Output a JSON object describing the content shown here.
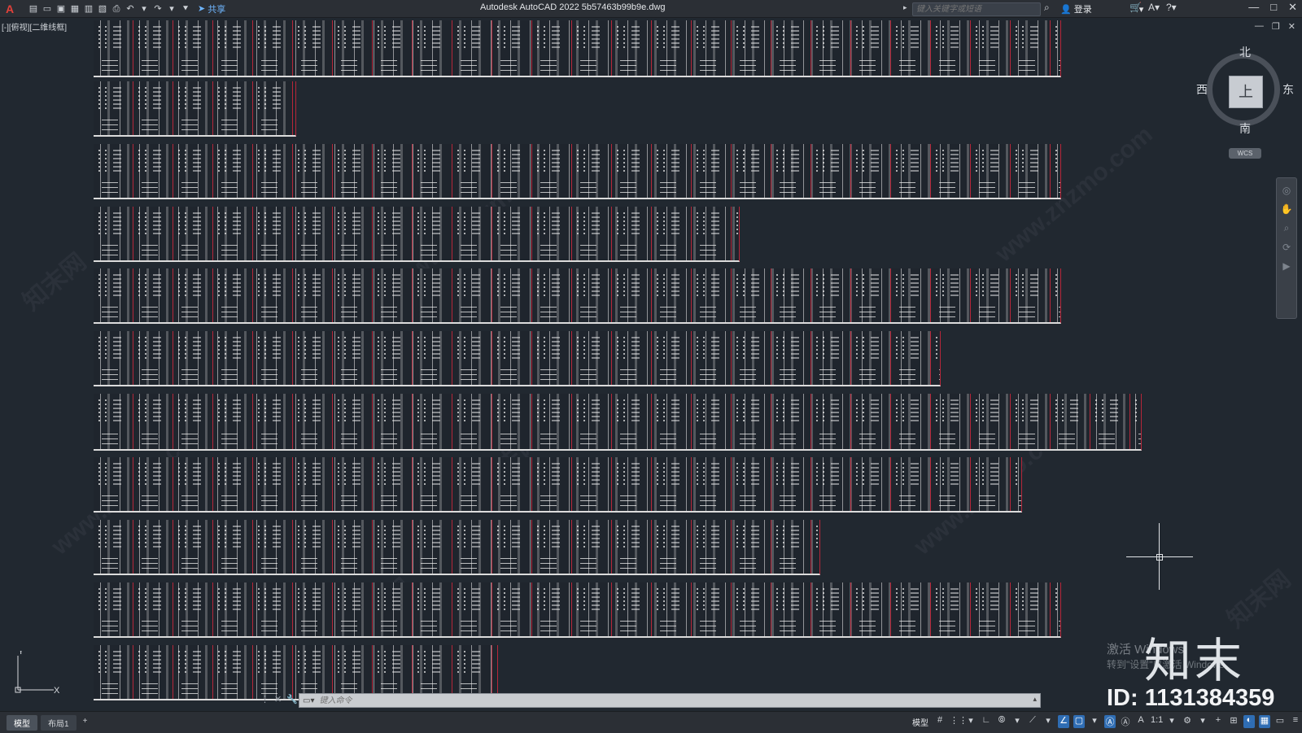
{
  "titlebar": {
    "app_logo": "A",
    "share_label": "共享",
    "title": "Autodesk AutoCAD 2022    5b57463b99b9e.dwg",
    "search_placeholder": "键入关键字或短语",
    "login_label": "登录"
  },
  "viewport_label": "[-][俯视][二维线框]",
  "viewcube": {
    "north": "北",
    "south": "南",
    "west": "西",
    "east": "东",
    "face": "上",
    "wcs_label": "WCS"
  },
  "watermarks": {
    "site": "www.znzmo.com",
    "site_cn": "知末网"
  },
  "brand": {
    "logo_text": "知末",
    "id_text": "ID: 1131384359",
    "activate_title": "激活 Windows",
    "activate_sub": "转到\"设置\"以激活 Windows。"
  },
  "ucs": {
    "x_label": "X",
    "y_label": "Y"
  },
  "command_line": {
    "placeholder": "键入命令"
  },
  "statusbar": {
    "tabs": [
      {
        "label": "模型"
      },
      {
        "label": "布局1"
      }
    ],
    "add_tab": "+",
    "model_label": "模型",
    "scale": "1:1"
  },
  "drawing": {
    "description_rows": 11
  }
}
